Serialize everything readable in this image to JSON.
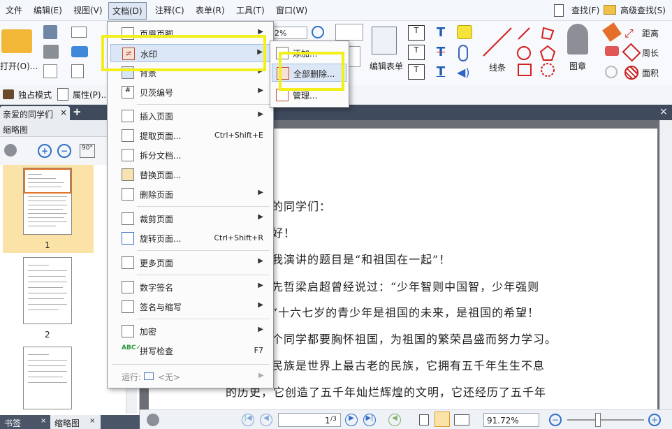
{
  "menubar": {
    "items": [
      "文件",
      "编辑(E)",
      "视图(V)",
      "文档(D)",
      "注释(C)",
      "表单(R)",
      "工具(T)",
      "窗口(W)"
    ],
    "find": "查找(F)",
    "advanced_find": "高级查找(S)"
  },
  "ribbon": {
    "open_label": "打开(O)...",
    "zoom_value": "2%",
    "edit_form_label": "编辑表单",
    "lines_label": "线条",
    "stamp_label": "图章",
    "distance_label": "距离",
    "perimeter_label": "周长",
    "area_label": "面积"
  },
  "toolbar2": {
    "exclusive_mode": "独占模式",
    "properties": "属性(P)..."
  },
  "tabs": {
    "doc_tab": "亲爱的同学们",
    "close": "×",
    "add": "+"
  },
  "left_panel": {
    "title": "缩略图",
    "thumbnail_numbers": [
      "1",
      "2"
    ],
    "bottom_tabs": [
      "书签",
      "缩略图"
    ]
  },
  "document": {
    "lines": [
      "的同学们：",
      "好！",
      "我演讲的题目是“和祖国在一起”！",
      "先哲梁启超曾经说过：“少年智则中国智，少年强则",
      "”十六七岁的青少年是祖国的未来，是祖国的希望！",
      "个同学都要胸怀祖国，为祖国的繁荣昌盛而努力学习。",
      "民族是世界上最古老的民族，它拥有五千年生生不息",
      "的历史，它创造了五千年灿烂辉煌的文明，它还经历了五千年"
    ]
  },
  "menu": {
    "items": [
      {
        "label": "页眉页脚",
        "arrow": "▶",
        "shortcut": ""
      },
      {
        "label": "水印",
        "arrow": "▶",
        "shortcut": ""
      },
      {
        "label": "背景",
        "arrow": "▶",
        "shortcut": ""
      },
      {
        "label": "贝茨编号",
        "arrow": "▶",
        "shortcut": ""
      },
      {
        "label": "插入页面",
        "arrow": "▶",
        "shortcut": ""
      },
      {
        "label": "提取页面...",
        "arrow": "",
        "shortcut": "Ctrl+Shift+E"
      },
      {
        "label": "拆分文档...",
        "arrow": "",
        "shortcut": ""
      },
      {
        "label": "替换页面...",
        "arrow": "",
        "shortcut": ""
      },
      {
        "label": "删除页面",
        "arrow": "▶",
        "shortcut": ""
      },
      {
        "label": "裁剪页面",
        "arrow": "▶",
        "shortcut": ""
      },
      {
        "label": "旋转页面...",
        "arrow": "",
        "shortcut": "Ctrl+Shift+R"
      },
      {
        "label": "更多页面",
        "arrow": "▶",
        "shortcut": ""
      },
      {
        "label": "数字签名",
        "arrow": "▶",
        "shortcut": ""
      },
      {
        "label": "签名与缩写",
        "arrow": "▶",
        "shortcut": ""
      },
      {
        "label": "加密",
        "arrow": "▶",
        "shortcut": ""
      },
      {
        "label": "拼写检查",
        "arrow": "",
        "shortcut": "F7"
      }
    ],
    "run_label": "运行:",
    "run_value": "<无>"
  },
  "submenu": {
    "items": [
      "添加...",
      "全部删除...",
      "管理..."
    ]
  },
  "status": {
    "page_input": "1",
    "page_total": "/3",
    "zoom": "91.72%"
  },
  "colors": {
    "highlight": "#f2ef1a",
    "menu_hover": "#dbe7f6",
    "thumb_selected": "#fbe3a7"
  }
}
